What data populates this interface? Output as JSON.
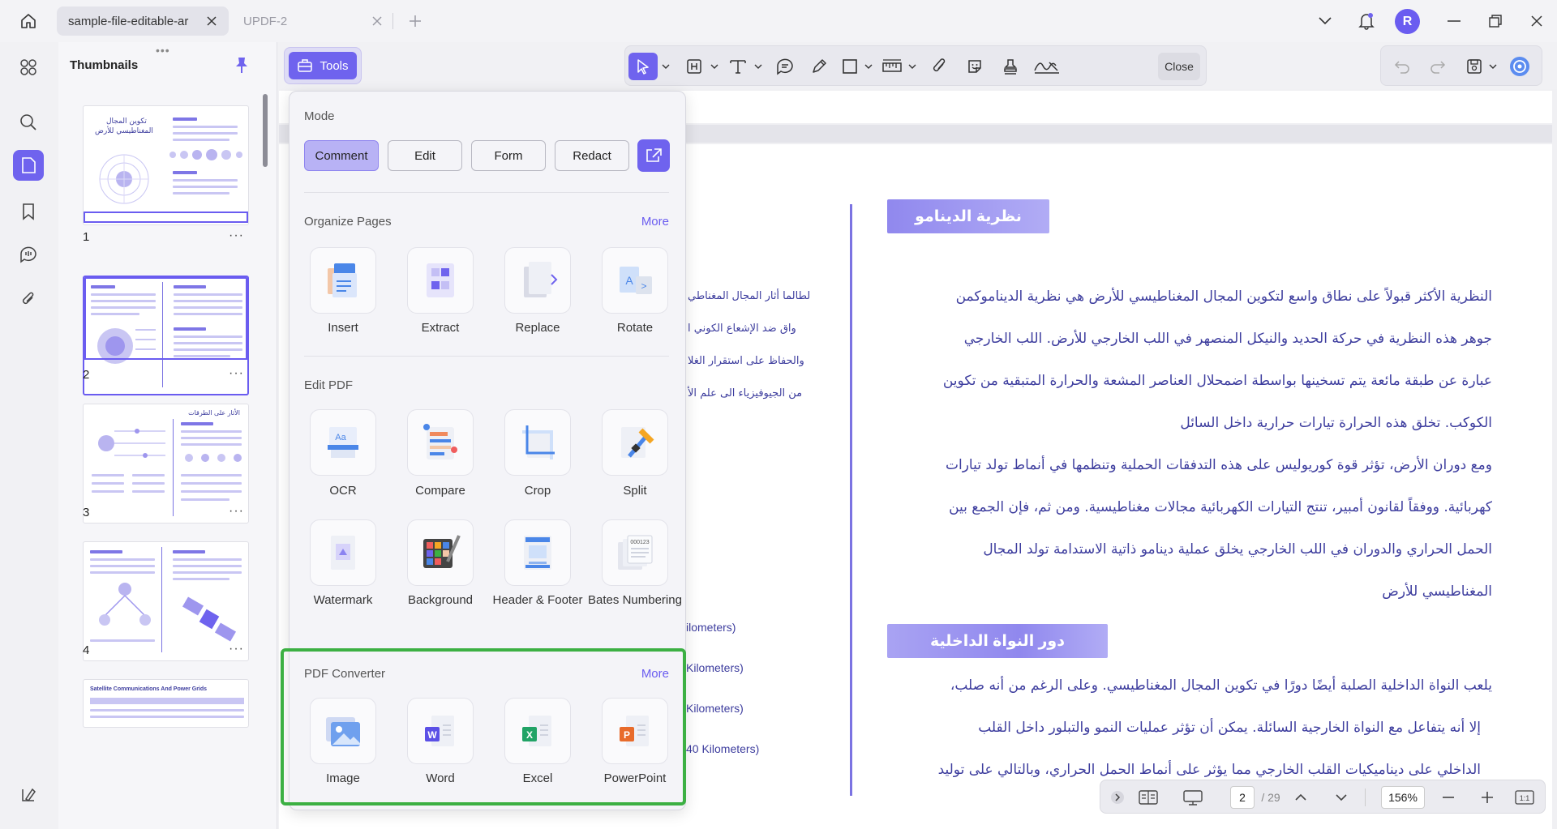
{
  "tabs": [
    {
      "label": "sample-file-editable-ar",
      "active": true
    },
    {
      "label": "UPDF-2",
      "active": false
    }
  ],
  "user": {
    "initial": "R"
  },
  "thumbnails": {
    "title": "Thumbnails",
    "pages": [
      {
        "num": "1",
        "more": "···"
      },
      {
        "num": "2",
        "more": "···"
      },
      {
        "num": "3",
        "more": "···"
      },
      {
        "num": "4",
        "more": "···"
      }
    ],
    "page1_title_line1": "تكوين المجال",
    "page1_title_line2": "المغناطيسي للأرض",
    "page3_title": "الأثار على الطرقات",
    "page5_title": "Satellite Communications And Power Grids"
  },
  "toolbar": {
    "tools_label": "Tools",
    "close_label": "Close"
  },
  "popup": {
    "mode": {
      "title": "Mode",
      "buttons": [
        "Comment",
        "Edit",
        "Form",
        "Redact"
      ],
      "active": "Comment"
    },
    "organize": {
      "title": "Organize Pages",
      "more": "More",
      "items": [
        "Insert",
        "Extract",
        "Replace",
        "Rotate"
      ]
    },
    "edit": {
      "title": "Edit PDF",
      "items": [
        "OCR",
        "Compare",
        "Crop",
        "Split",
        "Watermark",
        "Background",
        "Header & Footer",
        "Bates Numbering"
      ]
    },
    "converter": {
      "title": "PDF Converter",
      "more": "More",
      "items": [
        "Image",
        "Word",
        "Excel",
        "PowerPoint"
      ]
    }
  },
  "document": {
    "heading1": "نظرية الدينامو",
    "heading2": "دور النواة الداخلية",
    "para1": [
      "النظرية الأكثر قبولاً على نطاق واسع لتكوين المجال المغناطيسي للأرض هي نظرية الديناموكمن",
      "جوهر هذه النظرية في حركة الحديد والنيكل المنصهر في اللب الخارجي للأرض. اللب الخارجي",
      "عبارة عن طبقة مائعة يتم تسخينها بواسطة اضمحلال العناصر المشعة والحرارة المتبقية من تكوين",
      "الكوكب. تخلق هذه الحرارة تيارات حرارية داخل السائل"
    ],
    "para2": [
      "ومع دوران الأرض، تؤثر قوة كوريوليس على هذه التدفقات الحملية وتنظمها في أنماط تولد تيارات",
      "كهربائية. ووفقاً لقانون أمبير، تنتج التيارات الكهربائية مجالات مغناطيسية. ومن ثم، فإن الجمع بين",
      "الحمل الحراري والدوران في اللب الخارجي يخلق عملية دينامو ذاتية الاستدامة تولد المجال",
      "المغناطيسي للأرض"
    ],
    "para3": [
      "يلعب النواة الداخلية الصلبة أيضًا دورًا في تكوين المجال المغناطيسي. وعلى الرغم من أنه صلب،",
      "إلا أنه يتفاعل مع النواة الخارجية السائلة. يمكن أن تؤثر عمليات النمو والتبلور داخل القلب",
      "الداخلي على ديناميكيات القلب الخارجي مما يؤثر على أنماط الحمل الحراري، وبالتالي على توليد"
    ],
    "left_col": [
      "لطالما أثار المجال المغناطي",
      "واق ضد الإشعاع الكوني ا",
      "والحفاظ على استقرار الغلا",
      "من الجيوفيزياء الى علم الأ"
    ],
    "left_col_en": [
      "ilometers)",
      "Kilometers)",
      "Kilometers)",
      "40 Kilometers)"
    ]
  },
  "bottombar": {
    "page_current": "2",
    "page_total": "/ 29",
    "zoom": "156%"
  },
  "colors": {
    "accent": "#6f63ee",
    "highlight": "#3cb043",
    "doc_text": "#3d3d9e"
  }
}
